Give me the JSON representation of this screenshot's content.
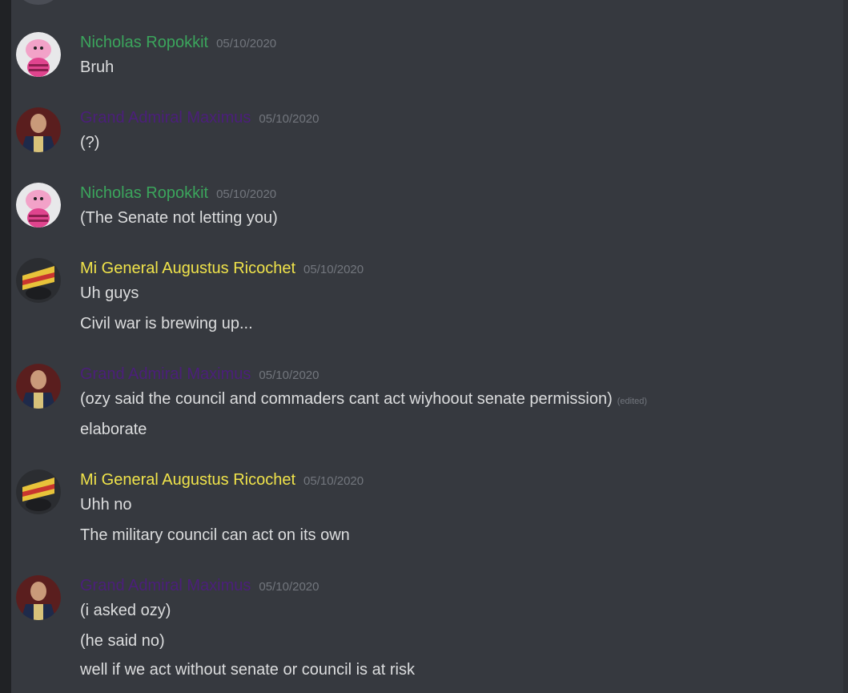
{
  "colors": {
    "background": "#36393f",
    "nicholas": "#3ba55c",
    "maximus": "#4b1f7a",
    "ricochet": "#f0e34a",
    "text": "#dcddde",
    "timestamp": "#72767d"
  },
  "messages": [
    {
      "author": "Nicholas Ropokkit",
      "timestamp": "05/10/2020",
      "avatar": "pink-pig-avatar",
      "lines": [
        "Bruh"
      ]
    },
    {
      "author": "Grand Admiral Maximus",
      "timestamp": "05/10/2020",
      "avatar": "admiral-portrait-avatar",
      "lines": [
        "(?)"
      ]
    },
    {
      "author": "Nicholas Ropokkit",
      "timestamp": "05/10/2020",
      "avatar": "pink-pig-avatar",
      "lines": [
        "(The Senate not letting you)"
      ]
    },
    {
      "author": "Mi General Augustus Ricochet",
      "timestamp": "05/10/2020",
      "avatar": "general-flag-avatar",
      "lines": [
        "Uh guys",
        "Civil war is brewing up..."
      ]
    },
    {
      "author": "Grand Admiral Maximus",
      "timestamp": "05/10/2020",
      "avatar": "admiral-portrait-avatar",
      "lines": [
        "(ozy said the council and commaders cant act wiyhoout senate permission)",
        "elaborate"
      ],
      "edited_label": "(edited)"
    },
    {
      "author": "Mi General Augustus Ricochet",
      "timestamp": "05/10/2020",
      "avatar": "general-flag-avatar",
      "lines": [
        "Uhh no",
        "The military council can act on its own"
      ]
    },
    {
      "author": "Grand Admiral Maximus",
      "timestamp": "05/10/2020",
      "avatar": "admiral-portrait-avatar",
      "lines": [
        "(i asked ozy)",
        "(he said no)",
        "well if we act without senate or council is at risk"
      ]
    }
  ]
}
